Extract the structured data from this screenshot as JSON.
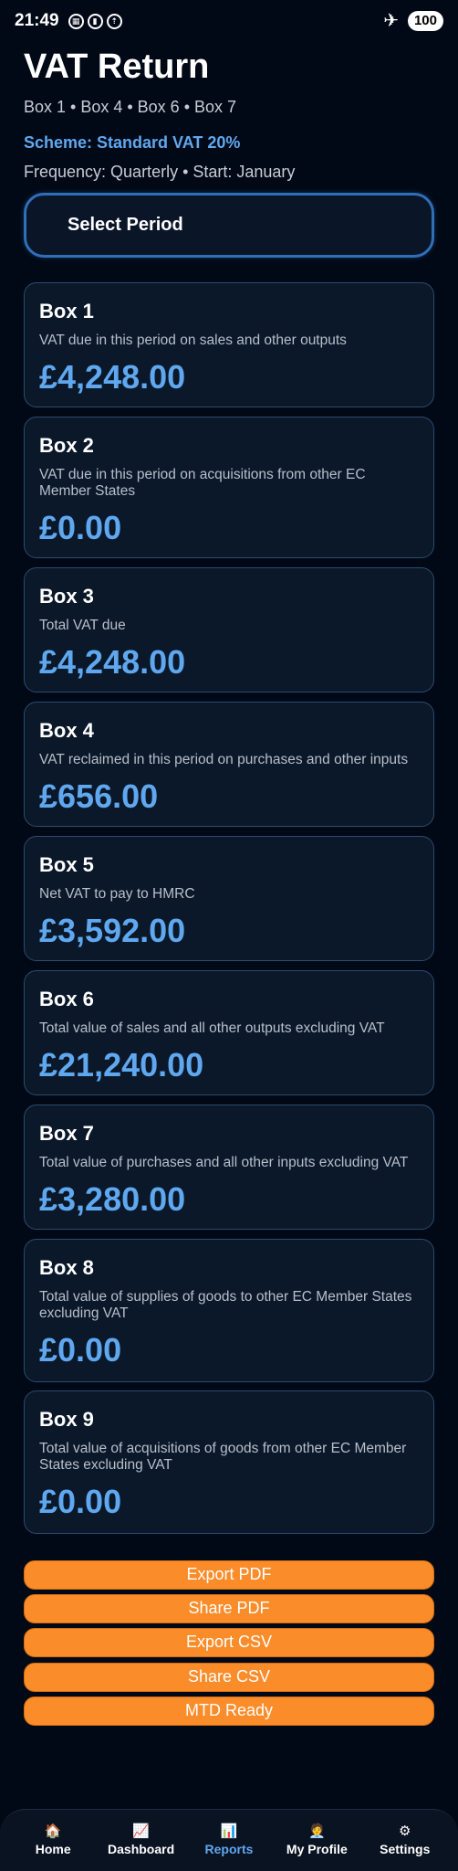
{
  "status_bar": {
    "time": "21:49",
    "battery": "100",
    "notification_icons": [
      "calendar-icon",
      "sim-icon",
      "upload-icon"
    ]
  },
  "header": {
    "title": "VAT Return",
    "subtitle": "Box 1 • Box 4 • Box 6 • Box 7",
    "scheme": "Scheme: Standard VAT 20%",
    "frequency": "Frequency: Quarterly • Start: January"
  },
  "select_period": {
    "label": "Select Period"
  },
  "boxes": [
    {
      "title": "Box 1",
      "description": "VAT due in this period on sales and other outputs",
      "value": "£4,248.00"
    },
    {
      "title": "Box 2",
      "description": "VAT due in this period on acquisitions from other EC Member States",
      "value": "£0.00"
    },
    {
      "title": "Box 3",
      "description": "Total VAT due",
      "value": "£4,248.00"
    },
    {
      "title": "Box 4",
      "description": "VAT reclaimed in this period on purchases and other inputs",
      "value": "£656.00"
    },
    {
      "title": "Box 5",
      "description": "Net VAT to pay to HMRC",
      "value": "£3,592.00"
    },
    {
      "title": "Box 6",
      "description": "Total value of sales and all other outputs excluding VAT",
      "value": "£21,240.00"
    },
    {
      "title": "Box 7",
      "description": "Total value of purchases and all other inputs excluding VAT",
      "value": "£3,280.00"
    },
    {
      "title": "Box 8",
      "description": "Total value of supplies of goods to other EC Member States excluding VAT",
      "value": "£0.00"
    },
    {
      "title": "Box 9",
      "description": "Total value of acquisitions of goods from other EC Member States excluding VAT",
      "value": "£0.00"
    }
  ],
  "actions": {
    "export_pdf": "Export PDF",
    "share_pdf": "Share PDF",
    "export_csv": "Export CSV",
    "share_csv": "Share CSV",
    "mtd_ready": "MTD Ready"
  },
  "nav": {
    "active": "Reports",
    "items": [
      {
        "icon": "🏠",
        "label": "Home"
      },
      {
        "icon": "📈",
        "label": "Dashboard"
      },
      {
        "icon": "📊",
        "label": "Reports"
      },
      {
        "icon": "🧑‍💼",
        "label": "My Profile"
      },
      {
        "icon": "⚙",
        "label": "Settings"
      }
    ]
  },
  "colors": {
    "background": "#020916",
    "accent_blue": "#5fa8f0",
    "button_orange": "#fb8c2a",
    "card_border": "#2b4a70"
  }
}
